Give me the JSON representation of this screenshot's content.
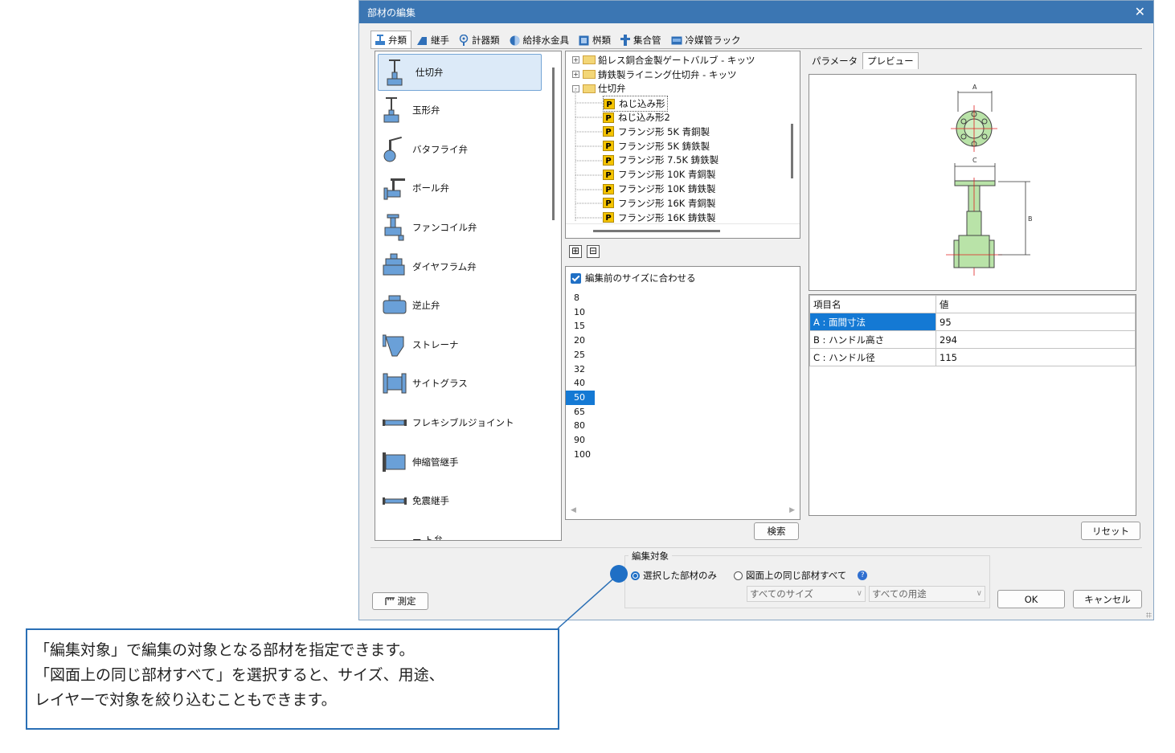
{
  "dialog": {
    "title": "部材の編集",
    "close_glyph": "✕"
  },
  "tabs": [
    {
      "label": "弁類",
      "icon": "valve-icon",
      "active": true
    },
    {
      "label": "継手",
      "icon": "fitting-icon"
    },
    {
      "label": "計器類",
      "icon": "meter-icon"
    },
    {
      "label": "給排水金具",
      "icon": "drain-fixture-icon"
    },
    {
      "label": "桝類",
      "icon": "basin-icon"
    },
    {
      "label": "集合管",
      "icon": "manifold-icon"
    },
    {
      "label": "冷媒管ラック",
      "icon": "refrigerant-rack-icon"
    }
  ],
  "part_types": [
    {
      "label": "仕切弁",
      "icon": "gate-valve-icon",
      "selected": true
    },
    {
      "label": "玉形弁",
      "icon": "globe-valve-icon"
    },
    {
      "label": "バタフライ弁",
      "icon": "butterfly-valve-icon"
    },
    {
      "label": "ボール弁",
      "icon": "ball-valve-icon"
    },
    {
      "label": "ファンコイル弁",
      "icon": "fan-coil-valve-icon"
    },
    {
      "label": "ダイヤフラム弁",
      "icon": "diaphragm-valve-icon"
    },
    {
      "label": "逆止弁",
      "icon": "check-valve-icon"
    },
    {
      "label": "ストレーナ",
      "icon": "strainer-icon"
    },
    {
      "label": "サイトグラス",
      "icon": "sight-glass-icon"
    },
    {
      "label": "フレキシブルジョイント",
      "icon": "flexible-joint-icon"
    },
    {
      "label": "伸縮管継手",
      "icon": "expansion-joint-icon"
    },
    {
      "label": "免震継手",
      "icon": "seismic-joint-icon"
    },
    {
      "label": "ー ト弁",
      "icon": "valve-partial-icon"
    }
  ],
  "tree": {
    "nodes": [
      {
        "label": "鉛レス銅合金製ゲートバルブ - キッツ",
        "kind": "folder",
        "expander": "+",
        "level": 0
      },
      {
        "label": "鋳鉄製ライニング仕切弁 - キッツ",
        "kind": "folder",
        "expander": "+",
        "level": 0
      },
      {
        "label": "仕切弁",
        "kind": "folder",
        "expander": "-",
        "level": 0
      },
      {
        "label": "ねじ込み形",
        "kind": "part",
        "level": 1,
        "selected": true
      },
      {
        "label": "ねじ込み形2",
        "kind": "part",
        "level": 1
      },
      {
        "label": "フランジ形 5K 青銅製",
        "kind": "part",
        "level": 1
      },
      {
        "label": "フランジ形 5K 鋳鉄製",
        "kind": "part",
        "level": 1
      },
      {
        "label": "フランジ形 7.5K 鋳鉄製",
        "kind": "part",
        "level": 1
      },
      {
        "label": "フランジ形 10K 青銅製",
        "kind": "part",
        "level": 1
      },
      {
        "label": "フランジ形 10K 鋳鉄製",
        "kind": "part",
        "level": 1
      },
      {
        "label": "フランジ形 16K 青銅製",
        "kind": "part",
        "level": 1
      },
      {
        "label": "フランジ形 16K 鋳鉄製",
        "kind": "part",
        "level": 1
      }
    ],
    "part_badge": "P",
    "expand_all_glyph": "⊞",
    "collapse_all_glyph": "⊟"
  },
  "sizes": {
    "match_label": "編集前のサイズに合わせる",
    "items": [
      "8",
      "10",
      "15",
      "20",
      "25",
      "32",
      "40",
      "50",
      "65",
      "80",
      "90",
      "100"
    ],
    "selected": "50"
  },
  "buttons": {
    "search": "検索",
    "reset": "リセット",
    "measure": "測定",
    "ok": "OK",
    "cancel": "キャンセル"
  },
  "right_tabs": [
    "パラメータ",
    "プレビュー"
  ],
  "preview": {
    "labels": [
      "A",
      "B",
      "C"
    ]
  },
  "params": {
    "headers": [
      "項目名",
      "値"
    ],
    "rows": [
      {
        "name": "A : 面間寸法",
        "value": "95",
        "selected": true
      },
      {
        "name": "B : ハンドル高さ",
        "value": "294"
      },
      {
        "name": "C : ハンドル径",
        "value": "115"
      }
    ]
  },
  "edit_target": {
    "title": "編集対象",
    "option1": "選択した部材のみ",
    "option2": "図面上の同じ部材すべて",
    "help_glyph": "?",
    "size_combo": "すべてのサイズ",
    "usage_combo": "すべての用途"
  },
  "callout": {
    "lines": [
      "「編集対象」で編集の対象となる部材を指定できます。",
      "「図面上の同じ部材すべて」を選択すると、サイズ、用途、",
      "レイヤーで対象を絞り込むこともできます。"
    ]
  },
  "colors": {
    "accent": "#1f6fc5",
    "titlebar": "#3b76b3",
    "selection": "#1479d4",
    "valve_green": "#b9e3a8"
  }
}
